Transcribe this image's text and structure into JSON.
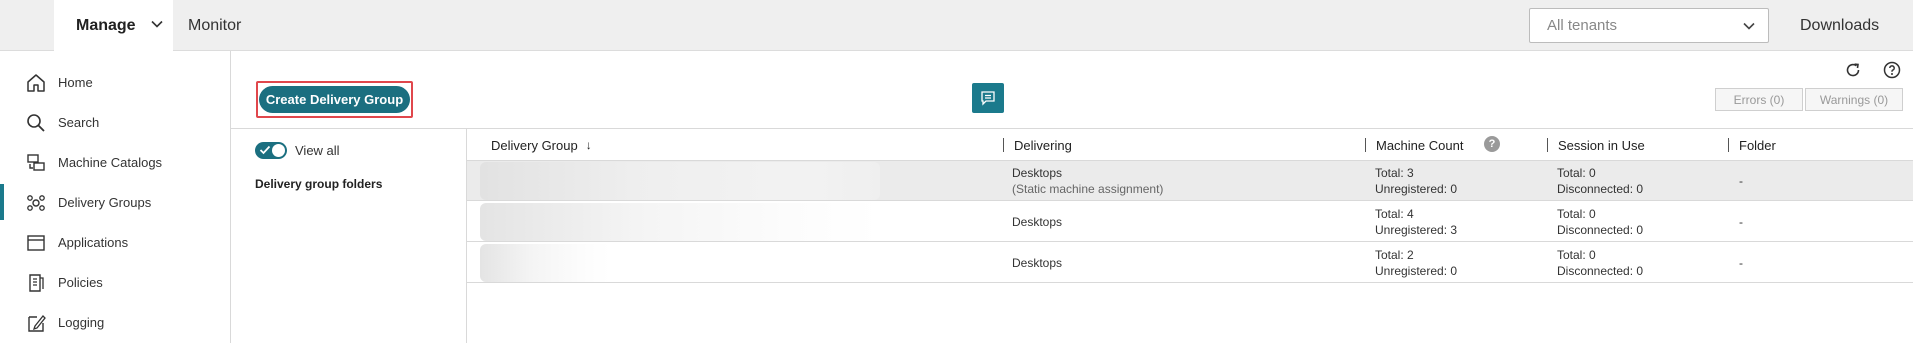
{
  "topbar": {
    "manage_label": "Manage",
    "monitor_label": "Monitor",
    "tenant_placeholder": "All tenants",
    "downloads_label": "Downloads"
  },
  "sidebar": {
    "items": [
      {
        "label": "Home",
        "icon": "home-icon"
      },
      {
        "label": "Search",
        "icon": "search-icon"
      },
      {
        "label": "Machine Catalogs",
        "icon": "machine-catalogs-icon"
      },
      {
        "label": "Delivery Groups",
        "icon": "delivery-groups-icon",
        "active": true
      },
      {
        "label": "Applications",
        "icon": "applications-icon"
      },
      {
        "label": "Policies",
        "icon": "policies-icon"
      },
      {
        "label": "Logging",
        "icon": "logging-icon"
      }
    ]
  },
  "toolbar": {
    "create_label": "Create Delivery Group",
    "errors_label": "Errors (0)",
    "warnings_label": "Warnings (0)"
  },
  "folders": {
    "view_all_label": "View all",
    "title": "Delivery group folders"
  },
  "table": {
    "columns": [
      "Delivery Group",
      "Delivering",
      "Machine Count",
      "Session in Use",
      "Folder"
    ],
    "sort_indicator": "↓",
    "info_mark": "?",
    "rows": [
      {
        "delivering": "Desktops",
        "delivering_sub": "(Static machine assignment)",
        "machine_total": "Total: 3",
        "machine_unreg": "Unregistered: 0",
        "session_total": "Total: 0",
        "session_disc": "Disconnected: 0",
        "folder": "-"
      },
      {
        "delivering": "Desktops",
        "delivering_sub": "",
        "machine_total": "Total: 4",
        "machine_unreg": "Unregistered: 3",
        "session_total": "Total: 0",
        "session_disc": "Disconnected: 0",
        "folder": "-"
      },
      {
        "delivering": "Desktops",
        "delivering_sub": "",
        "machine_total": "Total: 2",
        "machine_unreg": "Unregistered: 0",
        "session_total": "Total: 0",
        "session_disc": "Disconnected: 0",
        "folder": "-"
      }
    ]
  },
  "colors": {
    "accent": "#1b7a8c",
    "button": "#1b6f80",
    "highlight_outline": "#e0474c"
  }
}
